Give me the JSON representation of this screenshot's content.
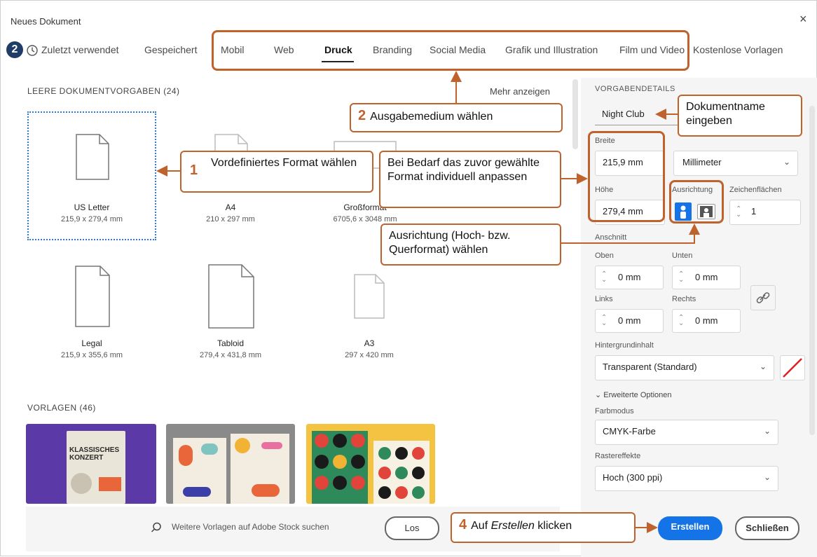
{
  "window": {
    "title": "Neues Dokument",
    "close": "×"
  },
  "badge": {
    "number": "2"
  },
  "tabs": [
    {
      "label": "Zuletzt verwendet"
    },
    {
      "label": "Gespeichert"
    },
    {
      "label": "Mobil"
    },
    {
      "label": "Web"
    },
    {
      "label": "Druck"
    },
    {
      "label": "Branding"
    },
    {
      "label": "Social Media"
    },
    {
      "label": "Grafik und Illustration"
    },
    {
      "label": "Film und Video"
    },
    {
      "label": "Kostenlose Vorlagen"
    }
  ],
  "presets": {
    "heading": "LEERE DOKUMENTVORGABEN  (24)",
    "more": "Mehr anzeigen",
    "items": [
      {
        "name": "US Letter",
        "size": "215,9 x 279,4 mm"
      },
      {
        "name": "A4",
        "size": "210 x 297 mm"
      },
      {
        "name": "Großformat",
        "size": "6705,6 x 3048 mm"
      },
      {
        "name": "Legal",
        "size": "215,9 x 355,6 mm"
      },
      {
        "name": "Tabloid",
        "size": "279,4 x 431,8 mm"
      },
      {
        "name": "A3",
        "size": "297 x 420 mm"
      }
    ]
  },
  "templates": {
    "heading": "VORLAGEN  (46)",
    "t1_line1": "KLASSISCHES",
    "t1_line2": "KONZERT"
  },
  "details": {
    "heading": "VORGABENDETAILS",
    "doc_name": "Night Club",
    "width_label": "Breite",
    "width": "215,9 mm",
    "unit": "Millimeter",
    "height_label": "Höhe",
    "height": "279,4 mm",
    "orientation_label": "Ausrichtung",
    "artboards_label": "Zeichenflächen",
    "artboards": "1",
    "bleed_label": "Anschnitt",
    "top_label": "Oben",
    "top": "0 mm",
    "bottom_label": "Unten",
    "bottom": "0 mm",
    "left_label": "Links",
    "left": "0 mm",
    "right_label": "Rechts",
    "right": "0 mm",
    "bg_label": "Hintergrundinhalt",
    "bg": "Transparent (Standard)",
    "advanced": "Erweiterte Optionen",
    "colormode_label": "Farbmodus",
    "colormode": "CMYK-Farbe",
    "raster_label": "Rastereffekte",
    "raster": "Hoch (300 ppi)"
  },
  "bottom": {
    "search_placeholder": "Weitere Vorlagen auf Adobe Stock suchen",
    "go": "Los",
    "create": "Erstellen",
    "close": "Schließen"
  },
  "callouts": {
    "c1_num": "1",
    "c1_text": "Vordefiniertes Format wählen",
    "c2_num": "2",
    "c2_text": "Ausgabemedium wählen",
    "c3_text": "Bei Bedarf das zuvor gewählte Format individuell anpassen",
    "c4_text": "Ausrichtung (Hoch- bzw. Querformat) wählen",
    "c5_text": "Dokumentname eingeben",
    "c6_num": "4",
    "c6_pre": "Auf ",
    "c6_em": "Erstellen",
    "c6_post": " klicken"
  },
  "colors": {
    "accent": "#c0622b",
    "primary": "#1473e6",
    "selection": "#2d7be0",
    "badge": "#1f3d66"
  }
}
